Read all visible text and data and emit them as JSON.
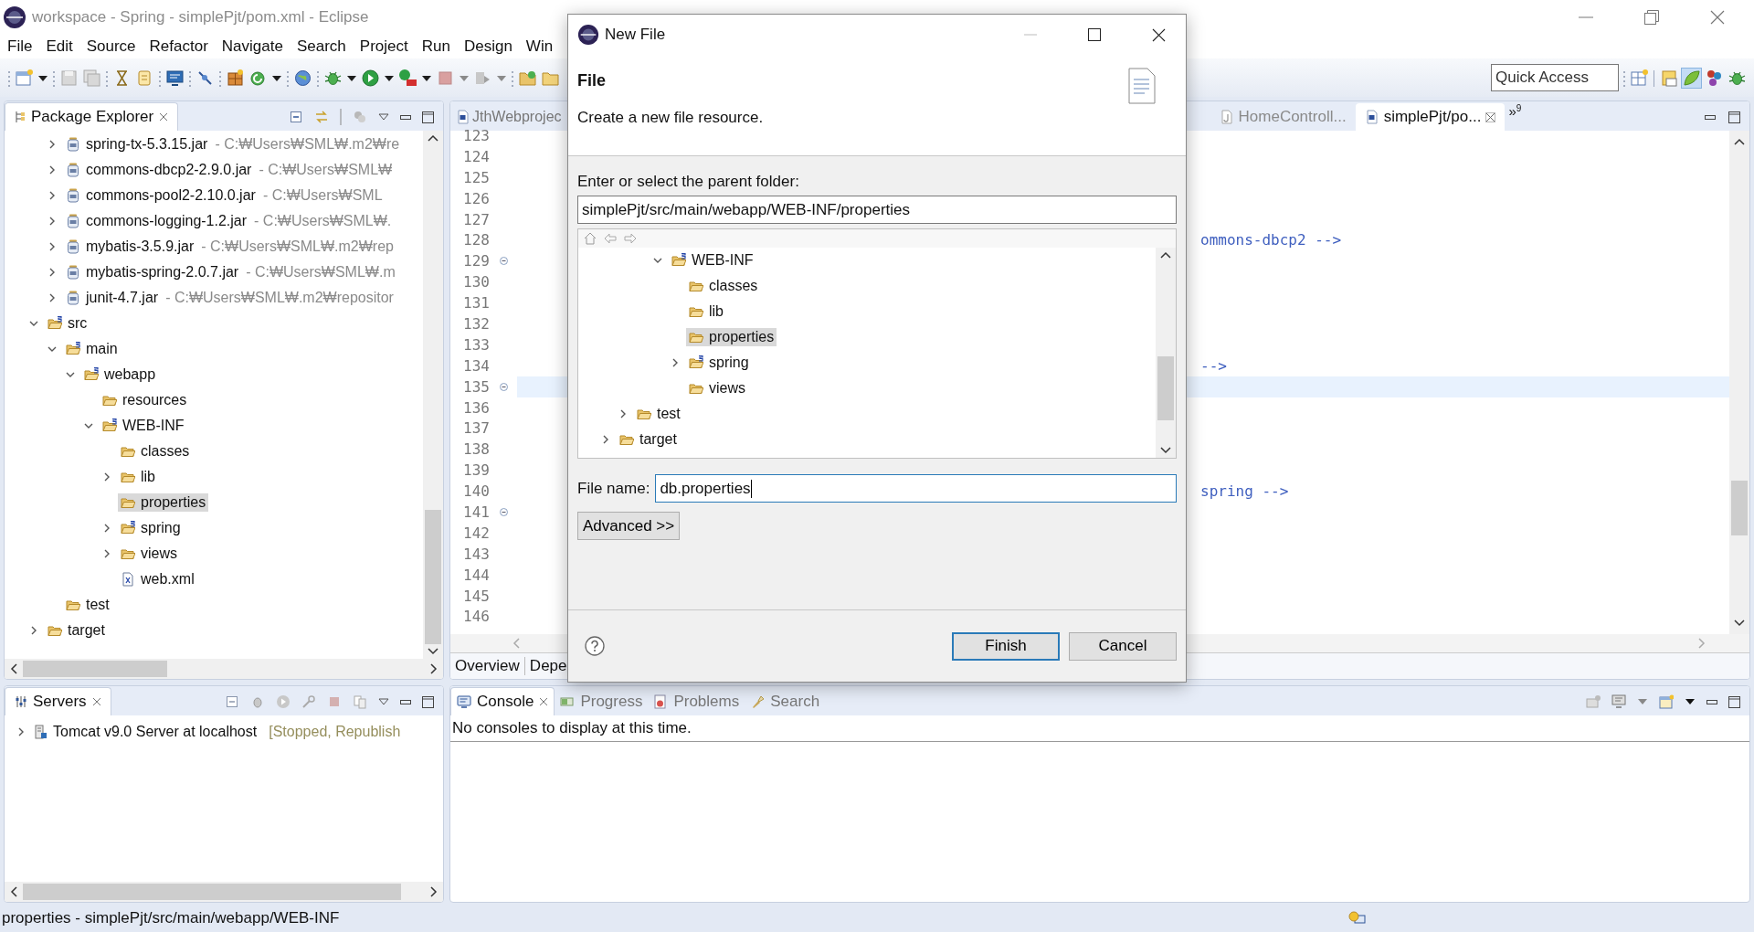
{
  "window": {
    "title": "workspace - Spring - simplePjt/pom.xml - Eclipse"
  },
  "menu": [
    "File",
    "Edit",
    "Source",
    "Refactor",
    "Navigate",
    "Search",
    "Project",
    "Run",
    "Design",
    "Win"
  ],
  "quick_access": {
    "placeholder": "Quick Access"
  },
  "package_explorer": {
    "title": "Package Explorer",
    "tree": [
      {
        "children": [
          {
            "label": "spring-tx-5.3.15.jar",
            "detail": "- C:₩Users₩SML₩.m2₩re",
            "kind": "jar",
            "expandable": true,
            "expanded": false,
            "selected": false
          },
          {
            "label": "commons-dbcp2-2.9.0.jar",
            "detail": "- C:₩Users₩SML₩",
            "kind": "jar",
            "expandable": true,
            "expanded": false,
            "selected": false
          },
          {
            "label": "commons-pool2-2.10.0.jar",
            "detail": "- C:₩Users₩SML",
            "kind": "jar",
            "expandable": true,
            "expanded": false,
            "selected": false
          },
          {
            "label": "commons-logging-1.2.jar",
            "detail": "- C:₩Users₩SML₩.",
            "kind": "jar",
            "expandable": true,
            "expanded": false,
            "selected": false
          },
          {
            "label": "mybatis-3.5.9.jar",
            "detail": "- C:₩Users₩SML₩.m2₩rep",
            "kind": "jar",
            "expandable": true,
            "expanded": false,
            "selected": false
          },
          {
            "label": "mybatis-spring-2.0.7.jar",
            "detail": "- C:₩Users₩SML₩.m",
            "kind": "jar",
            "expandable": true,
            "expanded": false,
            "selected": false
          },
          {
            "label": "junit-4.7.jar",
            "detail": "- C:₩Users₩SML₩.m2₩repositor",
            "kind": "jar",
            "expandable": true,
            "expanded": false,
            "selected": false
          }
        ]
      },
      {
        "label": "src",
        "kind": "source-folder",
        "expandable": true,
        "expanded": true,
        "selected": false,
        "children": [
          {
            "label": "main",
            "kind": "source-folder",
            "expandable": true,
            "expanded": true,
            "selected": false,
            "children": [
              {
                "label": "webapp",
                "kind": "source-folder",
                "expandable": true,
                "expanded": true,
                "selected": false,
                "children": [
                  {
                    "label": "resources",
                    "kind": "folder",
                    "expandable": false,
                    "selected": false
                  },
                  {
                    "label": "WEB-INF",
                    "kind": "source-folder",
                    "expandable": true,
                    "expanded": true,
                    "selected": false,
                    "children": [
                      {
                        "label": "classes",
                        "kind": "folder",
                        "expandable": false,
                        "selected": false
                      },
                      {
                        "label": "lib",
                        "kind": "folder",
                        "expandable": true,
                        "expanded": false,
                        "selected": false
                      },
                      {
                        "label": "properties",
                        "kind": "folder",
                        "expandable": false,
                        "selected": true
                      },
                      {
                        "label": "spring",
                        "kind": "source-folder",
                        "expandable": true,
                        "expanded": false,
                        "selected": false
                      },
                      {
                        "label": "views",
                        "kind": "folder",
                        "expandable": true,
                        "expanded": false,
                        "selected": false
                      },
                      {
                        "label": "web.xml",
                        "kind": "xml-file",
                        "expandable": false,
                        "selected": false
                      }
                    ]
                  }
                ]
              }
            ]
          },
          {
            "label": "test",
            "kind": "folder",
            "expandable": false,
            "selected": false
          }
        ]
      },
      {
        "label": "target",
        "kind": "folder",
        "expandable": true,
        "expanded": false,
        "selected": false
      }
    ]
  },
  "editor": {
    "tabs": [
      {
        "label": "JthWebprojec",
        "kind": "maven-file",
        "selected": false,
        "closable": false
      },
      {
        "label": "HomeControll...",
        "kind": "java-file",
        "selected": false,
        "closable": false
      },
      {
        "label": "simplePjt/po...",
        "kind": "maven-file",
        "selected": true,
        "closable": true
      }
    ],
    "overflow": {
      "symbol": "»",
      "count": "9"
    },
    "lines": [
      {
        "number": "123",
        "fold": false,
        "current": false
      },
      {
        "number": "124",
        "fold": false,
        "current": false
      },
      {
        "number": "125",
        "fold": false,
        "current": false
      },
      {
        "number": "126",
        "fold": false,
        "current": false
      },
      {
        "number": "127",
        "fold": false,
        "current": false
      },
      {
        "number": "128",
        "fold": false,
        "current": false,
        "code": "ommons-dbcp2 -->"
      },
      {
        "number": "129",
        "fold": true,
        "current": false
      },
      {
        "number": "130",
        "fold": false,
        "current": false
      },
      {
        "number": "131",
        "fold": false,
        "current": false
      },
      {
        "number": "132",
        "fold": false,
        "current": false
      },
      {
        "number": "133",
        "fold": false,
        "current": false
      },
      {
        "number": "134",
        "fold": false,
        "current": false,
        "code": "-->"
      },
      {
        "number": "135",
        "fold": true,
        "current": true
      },
      {
        "number": "136",
        "fold": false,
        "current": false
      },
      {
        "number": "137",
        "fold": false,
        "current": false
      },
      {
        "number": "138",
        "fold": false,
        "current": false
      },
      {
        "number": "139",
        "fold": false,
        "current": false
      },
      {
        "number": "140",
        "fold": false,
        "current": false,
        "code": "spring -->"
      },
      {
        "number": "141",
        "fold": true,
        "current": false
      },
      {
        "number": "142",
        "fold": false,
        "current": false
      },
      {
        "number": "143",
        "fold": false,
        "current": false
      },
      {
        "number": "144",
        "fold": false,
        "current": false
      },
      {
        "number": "145",
        "fold": false,
        "current": false
      },
      {
        "number": "146",
        "fold": false,
        "current": false
      }
    ],
    "page_tabs": [
      "Overview",
      "Depe"
    ]
  },
  "servers": {
    "title": "Servers",
    "items": [
      {
        "label": "Tomcat v9.0 Server at localhost",
        "status": "[Stopped, Republish",
        "expandable": true,
        "expanded": false
      }
    ]
  },
  "console": {
    "tabs": [
      {
        "label": "Console",
        "kind": "console",
        "selected": true
      },
      {
        "label": "Progress",
        "kind": "progress",
        "selected": false
      },
      {
        "label": "Problems",
        "kind": "problems",
        "selected": false
      },
      {
        "label": "Search",
        "kind": "search",
        "selected": false
      }
    ],
    "message": "No consoles to display at this time."
  },
  "status_bar": {
    "text": "properties - simplePjt/src/main/webapp/WEB-INF"
  },
  "dialog": {
    "title": "New File",
    "heading": "File",
    "description": "Create a new file resource.",
    "folder_label": "Enter or select the parent folder:",
    "folder_value": "simplePjt/src/main/webapp/WEB-INF/properties",
    "folder_tree": [
      {
        "children": [
          {
            "children": [
              {
                "children": [
                  {
                    "label": "WEB-INF",
                    "kind": "source-folder",
                    "expandable": true,
                    "expanded": true,
                    "selected": false,
                    "children": [
                      {
                        "label": "classes",
                        "kind": "folder",
                        "expandable": false,
                        "selected": false
                      },
                      {
                        "label": "lib",
                        "kind": "folder",
                        "expandable": false,
                        "selected": false
                      },
                      {
                        "label": "properties",
                        "kind": "folder",
                        "expandable": false,
                        "selected": true
                      },
                      {
                        "label": "spring",
                        "kind": "source-folder",
                        "expandable": true,
                        "expanded": false,
                        "selected": false
                      },
                      {
                        "label": "views",
                        "kind": "folder",
                        "expandable": false,
                        "selected": false
                      }
                    ]
                  }
                ]
              }
            ]
          },
          {
            "label": "test",
            "kind": "folder",
            "expandable": true,
            "expanded": false,
            "selected": false
          }
        ]
      },
      {
        "label": "target",
        "kind": "folder",
        "expandable": true,
        "expanded": false,
        "selected": false
      }
    ],
    "file_name_label": "File name:",
    "file_name_value": "db.properties",
    "advanced_button": "Advanced >>",
    "buttons": [
      {
        "label": "Finish",
        "default": true
      },
      {
        "label": "Cancel",
        "default": false
      }
    ]
  }
}
